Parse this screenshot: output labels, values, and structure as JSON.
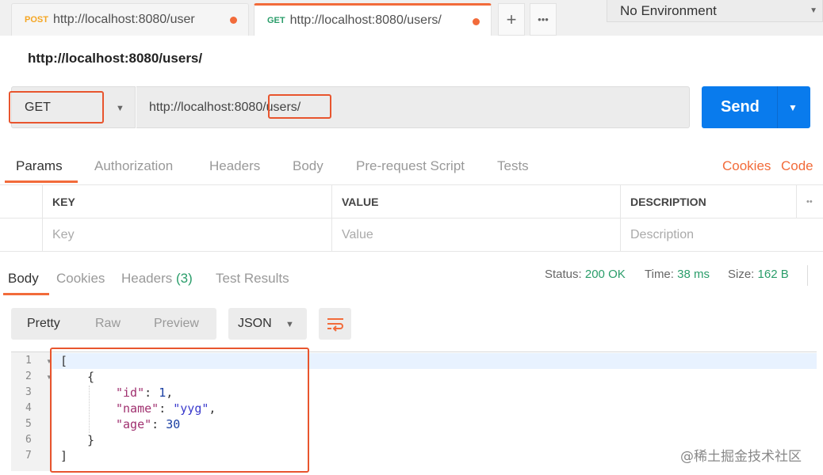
{
  "tabs": [
    {
      "method": "POST",
      "url": "http://localhost:8080/user"
    },
    {
      "method": "GET",
      "url": "http://localhost:8080/users/"
    }
  ],
  "tab_actions": {
    "add": "+",
    "more": "•••"
  },
  "environment": "No Environment",
  "request_title": "http://localhost:8080/users/",
  "method": "GET",
  "url": "http://localhost:8080/users/",
  "send_label": "Send",
  "request_tabs": [
    "Params",
    "Authorization",
    "Headers",
    "Body",
    "Pre-request Script",
    "Tests"
  ],
  "request_links": [
    "Cookies",
    "Code"
  ],
  "params_table": {
    "headers": [
      "KEY",
      "VALUE",
      "DESCRIPTION"
    ],
    "placeholders": [
      "Key",
      "Value",
      "Description"
    ],
    "more": "••"
  },
  "response_tabs": {
    "body": "Body",
    "cookies": "Cookies",
    "headers": "Headers",
    "headers_count": "(3)",
    "tests": "Test Results"
  },
  "status": {
    "label": "Status:",
    "value": "200 OK"
  },
  "time": {
    "label": "Time:",
    "value": "38 ms"
  },
  "size": {
    "label": "Size:",
    "value": "162 B"
  },
  "view_modes": [
    "Pretty",
    "Raw",
    "Preview"
  ],
  "format": "JSON",
  "line_numbers": [
    "1",
    "2",
    "3",
    "4",
    "5",
    "6",
    "7"
  ],
  "code": {
    "open_bracket": "[",
    "open_brace": "{",
    "id_key": "\"id\"",
    "id_value": "1",
    "name_key": "\"name\"",
    "name_value": "\"yyg\"",
    "age_key": "\"age\"",
    "age_value": "30",
    "close_brace": "}",
    "close_bracket": "]",
    "colon": ": ",
    "comma": ","
  },
  "watermark": "@稀土掘金技术社区",
  "colors": {
    "accent": "#f26b3a",
    "send": "#097bed",
    "status_ok": "#2a9d6a",
    "highlight": "#e8552e"
  }
}
